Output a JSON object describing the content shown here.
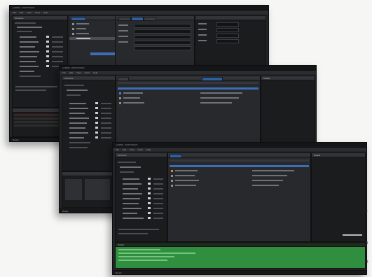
{
  "windows": [
    {
      "title": "LOUPE - IDENTIFIERS",
      "window_controls": "_ □ ×",
      "menu": [
        "File",
        "Edit",
        "View",
        "Tools",
        "Help"
      ],
      "left_panel_title": "Accounts",
      "status_text": "Ready"
    },
    {
      "title": "LOUPE - IDENTIFIERS",
      "window_controls": "_ □ ×",
      "menu": [
        "File",
        "Edit",
        "View",
        "Tools",
        "Help"
      ],
      "left_panel_title": "Accounts",
      "right_panel_title": "Details",
      "status_text": "Ready"
    },
    {
      "title": "LOUPE - IDENTIFIERS",
      "window_controls": "_ □ ×",
      "menu": [
        "File",
        "Edit",
        "View",
        "Tools",
        "Help"
      ],
      "left_panel_title": "Accounts",
      "right_panel_title": "Details",
      "console_title": "Output",
      "status_text": "Ready"
    }
  ],
  "edge_characters": [
    "J",
    "I",
    "B",
    "R"
  ],
  "colors": {
    "window_bg": "#222427",
    "panel_bg": "#1b1c1e",
    "selection": "#3c6db5",
    "console_green": "#2f8f3f"
  }
}
